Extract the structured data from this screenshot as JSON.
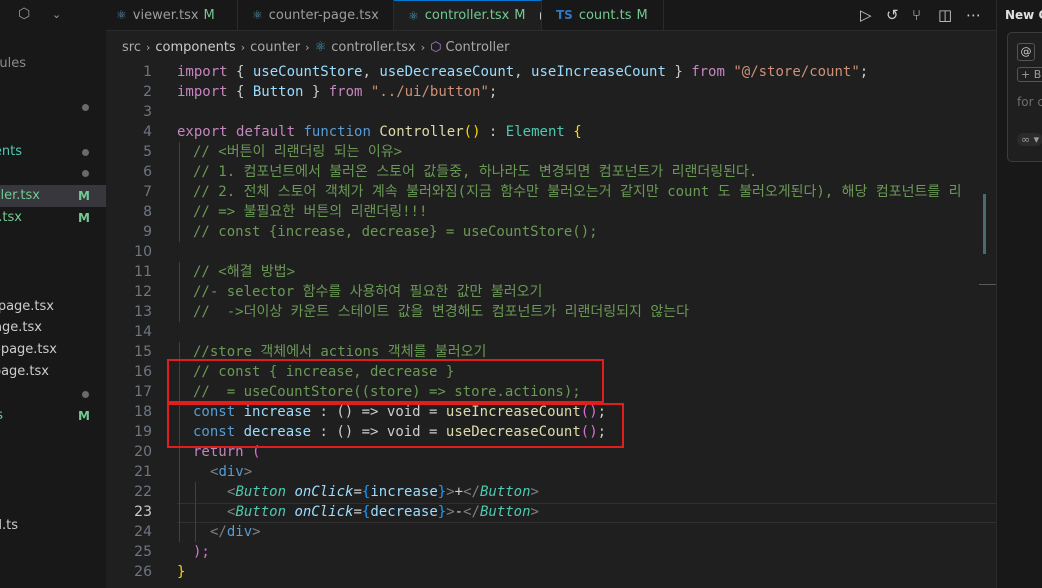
{
  "tabs": [
    {
      "label": "viewer.tsx",
      "status": "M",
      "icon": "react-icon"
    },
    {
      "label": "counter-page.tsx",
      "status": "",
      "icon": "react-icon"
    },
    {
      "label": "controller.tsx",
      "status": "M",
      "icon": "react-icon"
    },
    {
      "label": "count.ts",
      "status": "M",
      "icon": "ts-icon"
    }
  ],
  "breadcrumb": [
    "src",
    "components",
    "counter",
    "controller.tsx",
    "Controller"
  ],
  "explorer": [
    {
      "text": "dules",
      "status": ""
    },
    {
      "text": "",
      "status": "dot"
    },
    {
      "text": "ents",
      "status": "dot"
    },
    {
      "text": "",
      "status": "dot"
    },
    {
      "text": "ller.tsx",
      "status": "M"
    },
    {
      "text": "r.tsx",
      "status": "M"
    },
    {
      "text": "r-page.tsx",
      "status": ""
    },
    {
      "text": "age.tsx",
      "status": ""
    },
    {
      "text": "o-page.tsx",
      "status": ""
    },
    {
      "text": "-page.tsx",
      "status": ""
    },
    {
      "text": "",
      "status": "dot"
    },
    {
      "text": "s",
      "status": "M"
    },
    {
      "text": "d.ts",
      "status": ""
    }
  ],
  "chat": {
    "title": "New C",
    "at_label": "@",
    "add_label": "+ B",
    "placeholder": "for c",
    "infinity_label": "∞ ▾"
  },
  "editor": {
    "line_numbers": [
      "1",
      "2",
      "3",
      "4",
      "5",
      "6",
      "7",
      "8",
      "9",
      "10",
      "11",
      "12",
      "13",
      "14",
      "15",
      "16",
      "17",
      "18",
      "19",
      "20",
      "21",
      "22",
      "23",
      "24",
      "25",
      "26"
    ],
    "current_line": "23",
    "code": {
      "l1": {
        "kw_import": "import",
        "b": " { ",
        "v1": "useCountStore",
        "c1": ", ",
        "v2": "useDecreaseCount",
        "c2": ", ",
        "v3": "useIncreaseCount",
        "e": " } ",
        "kw_from": "from",
        "s": " ",
        "path": "\"@/store/count\"",
        "end": ";"
      },
      "l2": {
        "kw_import": "import",
        "b": " { ",
        "v1": "Button",
        "e": " } ",
        "kw_from": "from",
        "s": " ",
        "path": "\"../ui/button\"",
        "end": ";"
      },
      "l4": {
        "k1": "export",
        "s1": " ",
        "k2": "default",
        "s2": " ",
        "k3": "function",
        "s3": " ",
        "name": "Controller",
        "par": "()",
        "colon": " : ",
        "type": "Element",
        "brace": " {"
      },
      "l5": "// <버튼이 리랜더링 되는 이유>",
      "l6": "// 1. 컴포넌트에서 불러온 스토어 값들중, 하나라도 변경되면 컴포넌트가 리랜더링된다.",
      "l7": "// 2. 전체 스토어 객체가 계속 불러와짐(지금 함수만 불러오는거 같지만 count 도 불러오게된다), 해당 컴포넌트를 리",
      "l8": "// => 불필요한 버튼의 리랜더링!!!",
      "l9": "// const {increase, decrease} = useCountStore();",
      "l11": "// <해결 방법>",
      "l12": "//- selector 함수를 사용하여 필요한 값만 불러오기",
      "l13": "//  ->더이상 카운트 스테이트 값을 변경해도 컴포넌트가 리랜더링되지 않는다",
      "l15": "//store 객체에서 actions 객체를 불러오기",
      "l16": "// const { increase, decrease }",
      "l17": "//  = useCountStore((store) => store.actions);",
      "l18": {
        "kw": "const",
        "s": " ",
        "name": "increase",
        "colon": " : ",
        "type": "() => void",
        "eq": " = ",
        "fn": "useIncreaseCount",
        "par": "()",
        "end": ";"
      },
      "l19": {
        "kw": "const",
        "s": " ",
        "name": "decrease",
        "colon": " : ",
        "type": "() => void",
        "eq": " = ",
        "fn": "useDecreaseCount",
        "par": "()",
        "end": ";"
      },
      "l20": {
        "kw": "return",
        "p": " ("
      },
      "l21": {
        "lt": "<",
        "tag": "div",
        "gt": ">"
      },
      "l22": {
        "lt": "<",
        "comp": "Button",
        "s": " ",
        "attr": "onClick",
        "eq": "=",
        "ob": "{",
        "val": "increase",
        "cb": "}",
        "gt": ">",
        "text": "+",
        "clt": "</",
        "ccomp": "Button",
        "cgt": ">"
      },
      "l23": {
        "lt": "<",
        "comp": "Button",
        "s": " ",
        "attr": "onClick",
        "eq": "=",
        "ob": "{",
        "val": "decrease",
        "cb": "}",
        "gt": ">",
        "text": "-",
        "clt": "</",
        "ccomp": "Button",
        "cgt": ">"
      },
      "l24": {
        "lt": "</",
        "tag": "div",
        "gt": ">"
      },
      "l25": ");",
      "l26": "}"
    }
  }
}
